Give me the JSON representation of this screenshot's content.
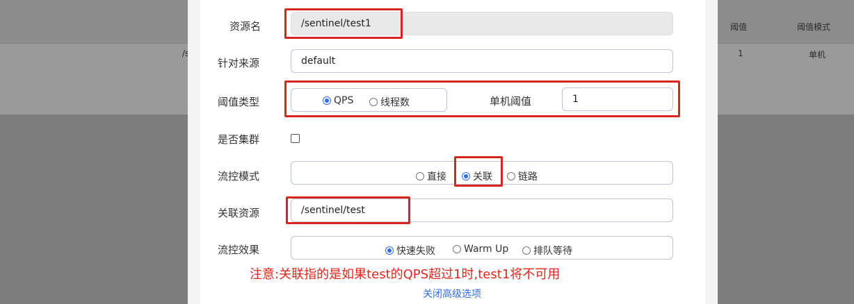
{
  "background": {
    "col_threshold": "阈值",
    "col_mode": "阈值模式",
    "row_threshold_value": "1",
    "row_mode_value": "单机",
    "row_fragment": "/s"
  },
  "form": {
    "resource_name_label": "资源名",
    "resource_name_value": "/sentinel/test1",
    "origin_label": "针对来源",
    "origin_value": "default",
    "threshold_type_label": "阈值类型",
    "threshold_type_options": [
      "QPS",
      "线程数"
    ],
    "threshold_type_selected": "QPS",
    "single_threshold_label": "单机阈值",
    "single_threshold_value": "1",
    "cluster_label": "是否集群",
    "flow_mode_label": "流控模式",
    "flow_mode_options": [
      "直接",
      "关联",
      "链路"
    ],
    "flow_mode_selected": "关联",
    "ref_resource_label": "关联资源",
    "ref_resource_value": "/sentinel/test",
    "effect_label": "流控效果",
    "effect_options": [
      "快速失败",
      "Warm Up",
      "排队等待"
    ],
    "effect_selected": "快速失败"
  },
  "annotation": {
    "note": "注意:关联指的是如果test的QPS超过1时,test1将不可用"
  },
  "footer": {
    "toggle_advanced": "关闭高级选项"
  },
  "colors": {
    "highlight": "#d9261c",
    "accent": "#2f6ee8"
  }
}
